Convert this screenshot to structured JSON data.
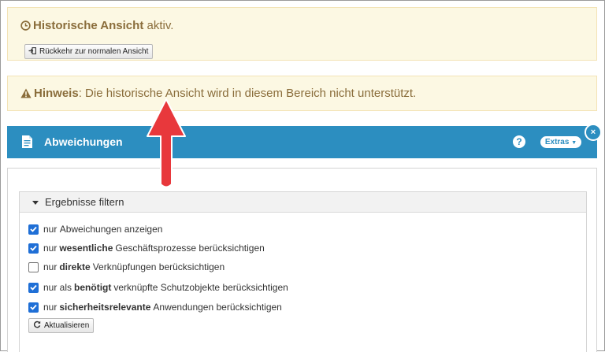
{
  "alert_history": {
    "title_bold": "Historische Ansicht",
    "title_rest": "aktiv.",
    "button_label": "Rückkehr zur normalen Ansicht",
    "icon": "clock-icon"
  },
  "alert_hint": {
    "label_bold": "Hinweis",
    "text": "Die historische Ansicht wird in diesem Bereich nicht unterstützt.",
    "icon": "warning-icon"
  },
  "panel": {
    "title": "Abweichungen",
    "help_label": "?",
    "extras_label": "Extras",
    "close_label": "×",
    "color": "#2c8ec0"
  },
  "filter": {
    "title": "Ergebnisse filtern",
    "options": [
      {
        "pre": "nur",
        "bold": "",
        "post": "Abweichungen anzeigen",
        "checked": true
      },
      {
        "pre": "nur",
        "bold": "wesentliche",
        "post": "Geschäftsprozesse berücksichtigen",
        "checked": true
      },
      {
        "pre": "nur",
        "bold": "direkte",
        "post": "Verknüpfungen berücksichtigen",
        "checked": false
      },
      {
        "pre": "nur als",
        "bold": "benötigt",
        "post": "verknüpfte Schutzobjekte berücksichtigen",
        "checked": true
      },
      {
        "pre": "nur",
        "bold": "sicherheitsrelevante",
        "post": "Anwendungen berücksichtigen",
        "checked": true
      }
    ],
    "refresh_label": "Aktualisieren"
  },
  "annotation": {
    "color": "#e8383c",
    "icon": "red-arrow-up"
  }
}
